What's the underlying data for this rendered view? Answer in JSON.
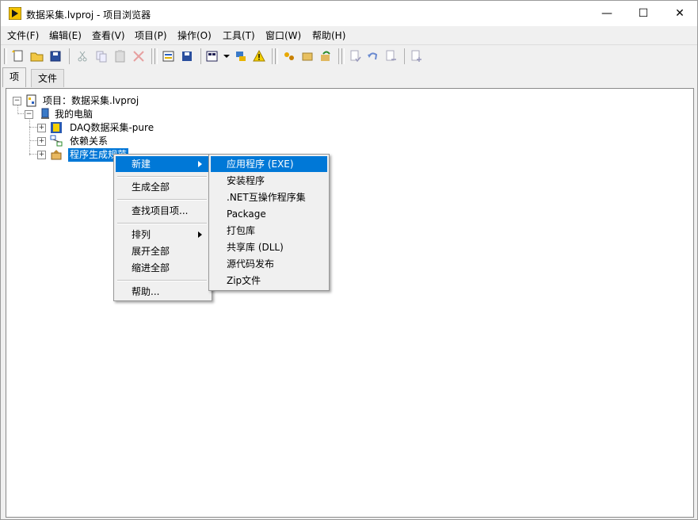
{
  "window": {
    "title": "数据采集.lvproj - 项目浏览器",
    "minimize_glyph": "—",
    "maximize_glyph": "☐",
    "close_glyph": "✕"
  },
  "menubar": [
    "文件(F)",
    "编辑(E)",
    "查看(V)",
    "项目(P)",
    "操作(O)",
    "工具(T)",
    "窗口(W)",
    "帮助(H)"
  ],
  "tabs": [
    "项",
    "文件"
  ],
  "tree": {
    "project": "项目：数据采集.lvproj",
    "my_computer": "我的电脑",
    "items": [
      "DAQ数据采集-pure",
      "依赖关系",
      "程序生成规范"
    ]
  },
  "context_menu": {
    "items": [
      "新建",
      "生成全部",
      "查找项目项...",
      "排列",
      "展开全部",
      "缩进全部",
      "帮助..."
    ]
  },
  "submenu": {
    "items": [
      "应用程序 (EXE)",
      "安装程序",
      ".NET互操作程序集",
      "Package",
      "打包库",
      "共享库 (DLL)",
      "源代码发布",
      "Zip文件"
    ]
  },
  "colors": {
    "selection": "#0078d7",
    "menu_bg": "#f0f0f0"
  },
  "icons": [
    "new-file-icon",
    "open-folder-icon",
    "save-all-icon",
    "cut-icon",
    "copy-icon",
    "paste-icon",
    "delete-icon",
    "project-properties-icon",
    "save-icon",
    "view-icon",
    "tools-icon",
    "warning-icon",
    "build-icon",
    "deploy-icon",
    "refresh-icon",
    "source-control-icon",
    "undo-icon",
    "checkout-icon",
    "add-icon"
  ]
}
